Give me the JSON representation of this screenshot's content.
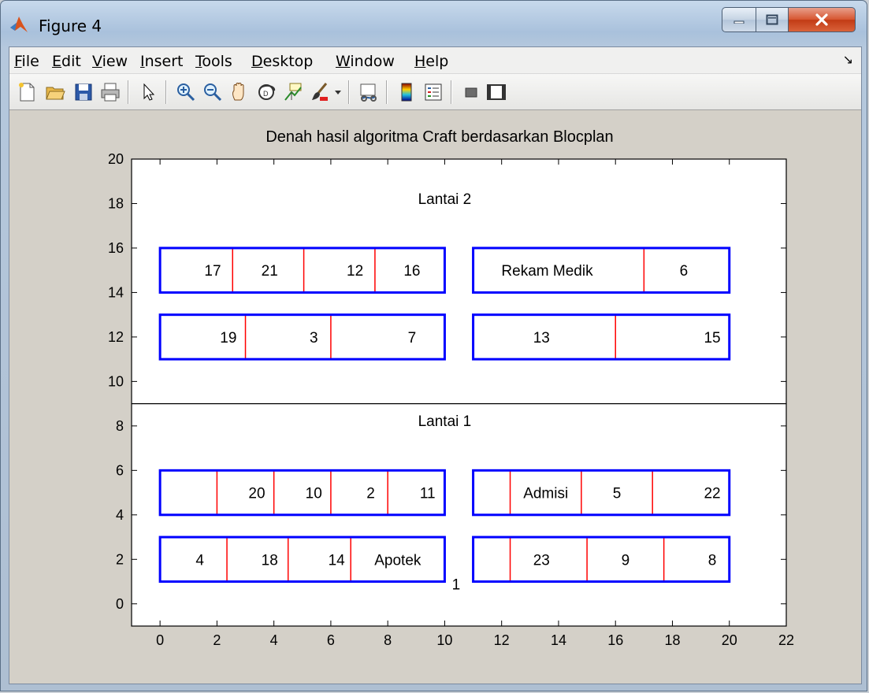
{
  "window": {
    "title": "Figure 4"
  },
  "menu": [
    "File",
    "Edit",
    "View",
    "Insert",
    "Tools",
    "Desktop",
    "Window",
    "Help"
  ],
  "toolbar": [
    "new-file-icon",
    "open-folder-icon",
    "save-icon",
    "print-icon",
    "pointer-icon",
    "zoom-in-icon",
    "zoom-out-icon",
    "pan-icon",
    "rotate-3d-icon",
    "data-cursor-icon",
    "brush-icon",
    "brush-dropdown-icon",
    "link-plot-icon",
    "colorbar-icon",
    "legend-icon",
    "hide-plot-tools-icon",
    "show-plot-tools-icon"
  ],
  "chart_data": {
    "type": "block-layout",
    "title": "Denah hasil algoritma Craft berdasarkan Blocplan",
    "xlim": [
      -1,
      22
    ],
    "ylim": [
      -1,
      20
    ],
    "xticks": [
      0,
      2,
      4,
      6,
      8,
      10,
      12,
      14,
      16,
      18,
      20,
      22
    ],
    "yticks": [
      0,
      2,
      4,
      6,
      8,
      10,
      12,
      14,
      16,
      18,
      20
    ],
    "floor_divider_y": 9,
    "floors": [
      {
        "label": "Lantai 2",
        "label_pos": [
          10,
          18.2
        ]
      },
      {
        "label": "Lantai 1",
        "label_pos": [
          10,
          8.2
        ]
      }
    ],
    "blocks": [
      {
        "x0": 0,
        "x1": 10,
        "y0": 14,
        "y1": 16,
        "dividers": [
          2.55,
          5.05,
          7.55
        ],
        "labels": [
          {
            "t": "17",
            "x": 1.85
          },
          {
            "t": "21",
            "x": 3.85
          },
          {
            "t": "12",
            "x": 6.85
          },
          {
            "t": "16",
            "x": 8.85
          }
        ]
      },
      {
        "x0": 11,
        "x1": 20,
        "y0": 14,
        "y1": 16,
        "dividers": [
          17
        ],
        "labels": [
          {
            "t": "Rekam Medik",
            "x": 13.6
          },
          {
            "t": "6",
            "x": 18.4
          }
        ]
      },
      {
        "x0": 0,
        "x1": 10,
        "y0": 11,
        "y1": 13,
        "dividers": [
          3,
          6
        ],
        "labels": [
          {
            "t": "19",
            "x": 2.4
          },
          {
            "t": "3",
            "x": 5.4
          },
          {
            "t": "7",
            "x": 8.85
          }
        ]
      },
      {
        "x0": 11,
        "x1": 20,
        "y0": 11,
        "y1": 13,
        "dividers": [
          16
        ],
        "labels": [
          {
            "t": "13",
            "x": 13.4
          },
          {
            "t": "15",
            "x": 19.4
          }
        ]
      },
      {
        "x0": 0,
        "x1": 10,
        "y0": 4,
        "y1": 6,
        "dividers": [
          2,
          4,
          6,
          8
        ],
        "labels": [
          {
            "t": "20",
            "x": 3.4
          },
          {
            "t": "10",
            "x": 5.4
          },
          {
            "t": "2",
            "x": 7.4
          },
          {
            "t": "11",
            "x": 9.4
          }
        ]
      },
      {
        "x0": 11,
        "x1": 20,
        "y0": 4,
        "y1": 6,
        "dividers": [
          12.3,
          14.8,
          17.3
        ],
        "labels": [
          {
            "t": "Admisi",
            "x": 13.55
          },
          {
            "t": "5",
            "x": 16.05
          },
          {
            "t": "22",
            "x": 19.4
          }
        ]
      },
      {
        "x0": 0,
        "x1": 10,
        "y0": 1,
        "y1": 3,
        "dividers": [
          2.35,
          4.5,
          6.7
        ],
        "labels": [
          {
            "t": "4",
            "x": 1.4
          },
          {
            "t": "18",
            "x": 3.85
          },
          {
            "t": "14",
            "x": 6.2
          },
          {
            "t": "Apotek",
            "x": 8.35
          }
        ]
      },
      {
        "x0": 11,
        "x1": 20,
        "y0": 1,
        "y1": 3,
        "dividers": [
          12.3,
          15,
          17.7
        ],
        "labels": [
          {
            "t": "23",
            "x": 13.4
          },
          {
            "t": "9",
            "x": 16.35
          },
          {
            "t": "8",
            "x": 19.4
          }
        ]
      }
    ],
    "annotations": [
      {
        "t": "1",
        "x": 10.4,
        "y": 0.9
      }
    ],
    "colors": {
      "block_border": "#0000ff",
      "divider": "#ff0000",
      "axes_bg": "#ffffff",
      "figure_bg": "#d4d0c8"
    }
  }
}
